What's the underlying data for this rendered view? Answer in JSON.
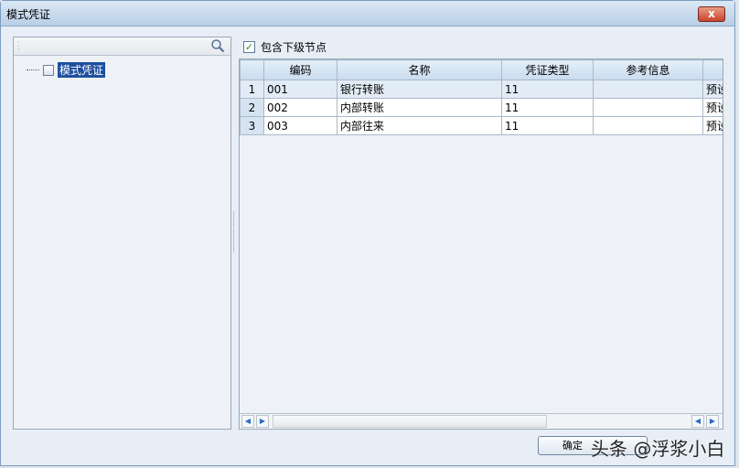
{
  "window": {
    "title": "模式凭证",
    "close_label": "x"
  },
  "tree": {
    "root": "模式凭证"
  },
  "include_children": {
    "label": "包含下级节点",
    "checked": true
  },
  "grid": {
    "columns": [
      "",
      "编码",
      "名称",
      "凭证类型",
      "参考信息",
      ""
    ],
    "rows": [
      {
        "n": "1",
        "code": "001",
        "name": "银行转账",
        "type": "11",
        "ref": "",
        "extra": "预设"
      },
      {
        "n": "2",
        "code": "002",
        "name": "内部转账",
        "type": "11",
        "ref": "",
        "extra": "预设"
      },
      {
        "n": "3",
        "code": "003",
        "name": "内部往来",
        "type": "11",
        "ref": "",
        "extra": "预设"
      }
    ]
  },
  "buttons": {
    "ok": "确定"
  },
  "watermark": "头条 @浮浆小白"
}
